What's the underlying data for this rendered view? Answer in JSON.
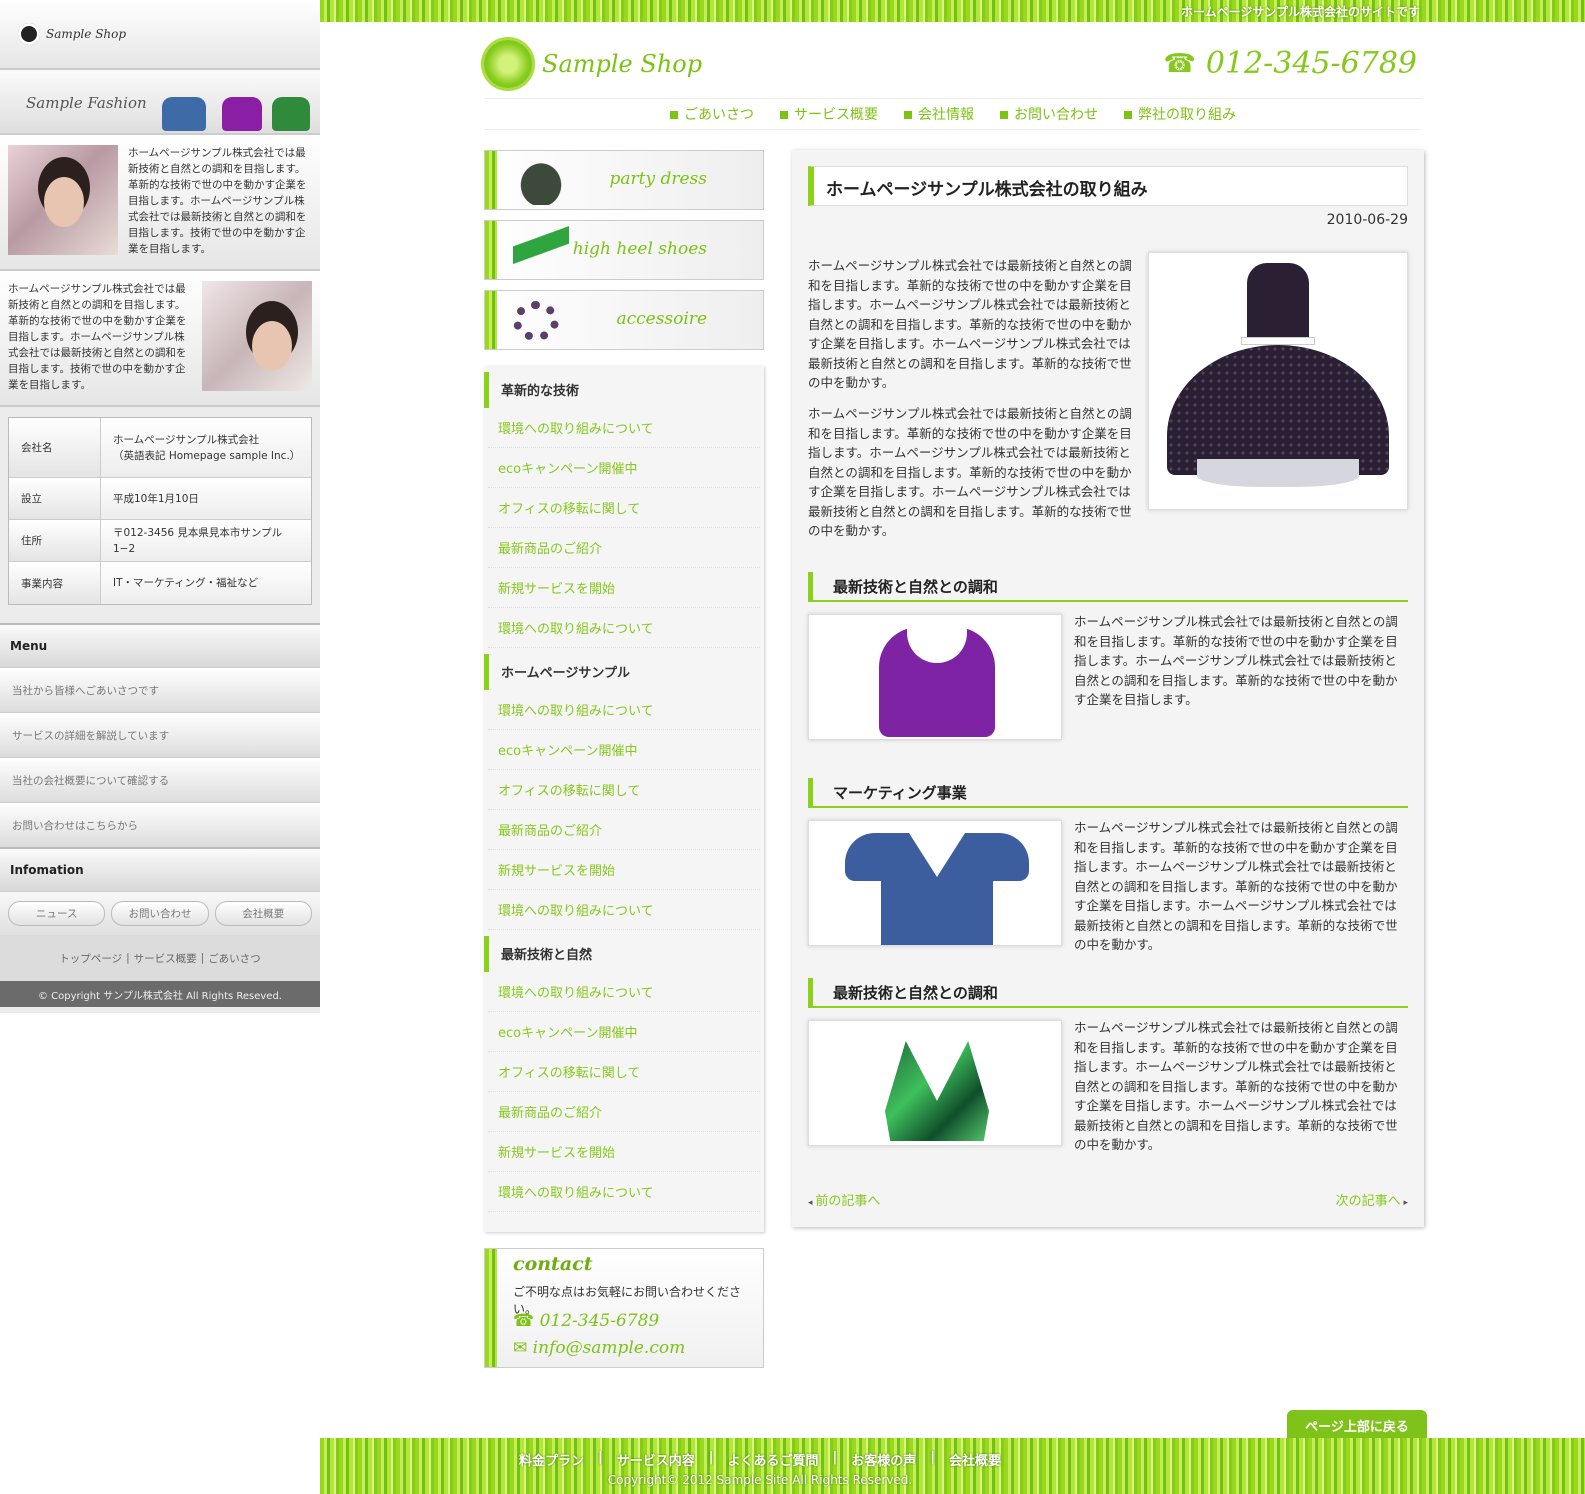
{
  "sidebar": {
    "logo": "Sample Shop",
    "fashion_label": "Sample Fashion",
    "profile1": "ホームページサンプル株式会社では最新技術と自然との調和を目指します。革新的な技術で世の中を動かす企業を目指します。ホームページサンプル株式会社では最新技術と自然との調和を目指します。技術で世の中を動かす企業を目指します。",
    "profile2": "ホームページサンプル株式会社では最新技術と自然との調和を目指します。革新的な技術で世の中を動かす企業を目指します。ホームページサンプル株式会社では最新技術と自然との調和を目指します。技術で世の中を動かす企業を目指します。",
    "company": [
      {
        "k": "会社名",
        "v": "ホームページサンプル株式会社\n（英語表記 Homepage sample Inc.）"
      },
      {
        "k": "設立",
        "v": "平成10年1月10日"
      },
      {
        "k": "住所",
        "v": "〒012-3456 見本県見本市サンプル1−2"
      },
      {
        "k": "事業内容",
        "v": "IT・マーケティング・福祉など"
      }
    ],
    "menu_heading": "Menu",
    "menu": [
      "当社から皆様へごあいさつです",
      "サービスの詳細を解説しています",
      "当社の会社概要について確認する",
      "お問い合わせはこちらから"
    ],
    "info_heading": "Infomation",
    "info_buttons": [
      "ニュース",
      "お問い合わせ",
      "会社概要"
    ],
    "links": [
      "トップページ",
      "サービス概要",
      "ごあいさつ"
    ],
    "copyright": "© Copyright サンプル株式会社 All Rights Reseved."
  },
  "header": {
    "tagline": "ホームページサンプル株式会社のサイトです",
    "logo": "Sample Shop",
    "phone": "012-345-6789",
    "nav": [
      "ごあいさつ",
      "サービス概要",
      "会社情報",
      "お問い合わせ",
      "弊社の取り組み"
    ]
  },
  "banners": [
    "party dress",
    "high heel shoes",
    "accessoire"
  ],
  "submenu": [
    {
      "heading": "革新的な技術",
      "items": [
        "環境への取り組みについて",
        "ecoキャンペーン開催中",
        "オフィスの移転に関して",
        "最新商品のご紹介",
        "新規サービスを開始",
        "環境への取り組みについて"
      ]
    },
    {
      "heading": "ホームページサンプル",
      "items": [
        "環境への取り組みについて",
        "ecoキャンペーン開催中",
        "オフィスの移転に関して",
        "最新商品のご紹介",
        "新規サービスを開始",
        "環境への取り組みについて"
      ]
    },
    {
      "heading": "最新技術と自然",
      "items": [
        "環境への取り組みについて",
        "ecoキャンペーン開催中",
        "オフィスの移転に関して",
        "最新商品のご紹介",
        "新規サービスを開始",
        "環境への取り組みについて"
      ]
    }
  ],
  "contact": {
    "title": "contact",
    "text": "ご不明な点はお気軽にお問い合わせください。",
    "phone": "012-345-6789",
    "email": "info@sample.com"
  },
  "article": {
    "title": "ホームページサンプル株式会社の取り組み",
    "date": "2010-06-29",
    "p1": "ホームページサンプル株式会社では最新技術と自然との調和を目指します。革新的な技術で世の中を動かす企業を目指します。ホームページサンプル株式会社では最新技術と自然との調和を目指します。革新的な技術で世の中を動かす企業を目指します。ホームページサンプル株式会社では最新技術と自然との調和を目指します。革新的な技術で世の中を動かす。",
    "p2": "ホームページサンプル株式会社では最新技術と自然との調和を目指します。革新的な技術で世の中を動かす企業を目指します。ホームページサンプル株式会社では最新技術と自然との調和を目指します。革新的な技術で世の中を動かす企業を目指します。ホームページサンプル株式会社では最新技術と自然との調和を目指します。革新的な技術で世の中を動かす。",
    "sections": [
      {
        "title": "最新技術と自然との調和",
        "text": "ホームページサンプル株式会社では最新技術と自然との調和を目指します。革新的な技術で世の中を動かす企業を目指します。ホームページサンプル株式会社では最新技術と自然との調和を目指します。革新的な技術で世の中を動かす企業を目指します。"
      },
      {
        "title": "マーケティング事業",
        "text": "ホームページサンプル株式会社では最新技術と自然との調和を目指します。革新的な技術で世の中を動かす企業を目指します。ホームページサンプル株式会社では最新技術と自然との調和を目指します。革新的な技術で世の中を動かす企業を目指します。ホームページサンプル株式会社では最新技術と自然との調和を目指します。革新的な技術で世の中を動かす。"
      },
      {
        "title": "最新技術と自然との調和",
        "text": "ホームページサンプル株式会社では最新技術と自然との調和を目指します。革新的な技術で世の中を動かす企業を目指します。ホームページサンプル株式会社では最新技術と自然との調和を目指します。革新的な技術で世の中を動かす企業を目指します。ホームページサンプル株式会社では最新技術と自然との調和を目指します。革新的な技術で世の中を動かす。"
      }
    ],
    "prev": "前の記事へ",
    "next": "次の記事へ"
  },
  "to_top": "ページ上部に戻る",
  "footer": {
    "nav": [
      "料金プラン",
      "サービス内容",
      "よくあるご質問",
      "お客様の声",
      "会社概要"
    ],
    "copyright": "Copyright© 2012 Sample Site All Rights Reserved."
  },
  "colors": {
    "accent": "#7cc314"
  }
}
